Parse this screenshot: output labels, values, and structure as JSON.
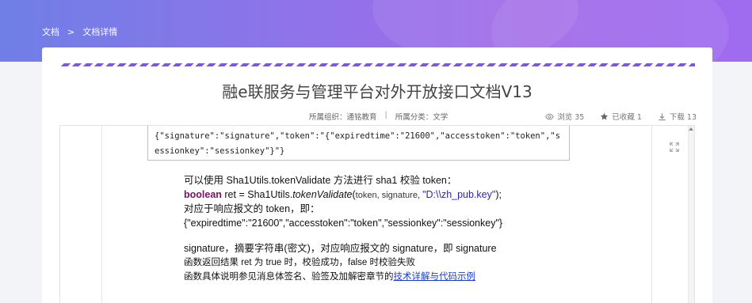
{
  "breadcrumb": {
    "root": "文档",
    "separator": ">",
    "current": "文档详情"
  },
  "doc": {
    "title": "融e联服务与管理平台对外开放接口文档V13",
    "org_label": "所属组织：通铭教育",
    "meta_separator": "|",
    "category_label": "所属分类：文学"
  },
  "stats": {
    "views": "浏览 35",
    "favorites": "已收藏 1",
    "downloads": "下载 13"
  },
  "viewer": {
    "code_text": "{\"signature\":\"signature\",\"token\":\"{\"expiredtime\":\"21600\",\"accesstoken\":\"token\",\"sessionkey\":\"sessionkey\"}\"}",
    "l1_a": "可以使用 ",
    "l1_b": "Sha1Utils.tokenValidate",
    "l1_c": " 方法进行 ",
    "l1_d": "sha1",
    "l1_e": " 校验 ",
    "l1_f": "token：",
    "l2_kw": "boolean",
    "l2_a": " ret = Sha1Utils.",
    "l2_method": "tokenValidate",
    "l2_b": "(",
    "l2_params": "token, signature, ",
    "l2_str": "\"D:\\\\zh_pub.key\"",
    "l2_c": ");",
    "l3": "对应于响应报文的 token，即：",
    "l4": "{\"expiredtime\":\"21600\",\"accesstoken\":\"token\",\"sessionkey\":\"sessionkey\"}",
    "l5": "signature，摘要字符串(密文)，对应响应报文的 signature，即 signature",
    "l6": "函数返回结果 ret 为 true 时，校验成功，false 时校验失败",
    "l7_a": "函数具体说明参见消息体签名、验签及加解密章节的",
    "l7_link": "技术详解与代码示例"
  },
  "colors": {
    "accent": "#7a5ad8",
    "keyword": "#7a0f63",
    "string": "#2a1fb8",
    "link": "#1a3ccf"
  },
  "icons": {
    "views": "eye-icon",
    "favorites": "star-icon",
    "downloads": "download-icon",
    "expand": "expand-icon"
  }
}
